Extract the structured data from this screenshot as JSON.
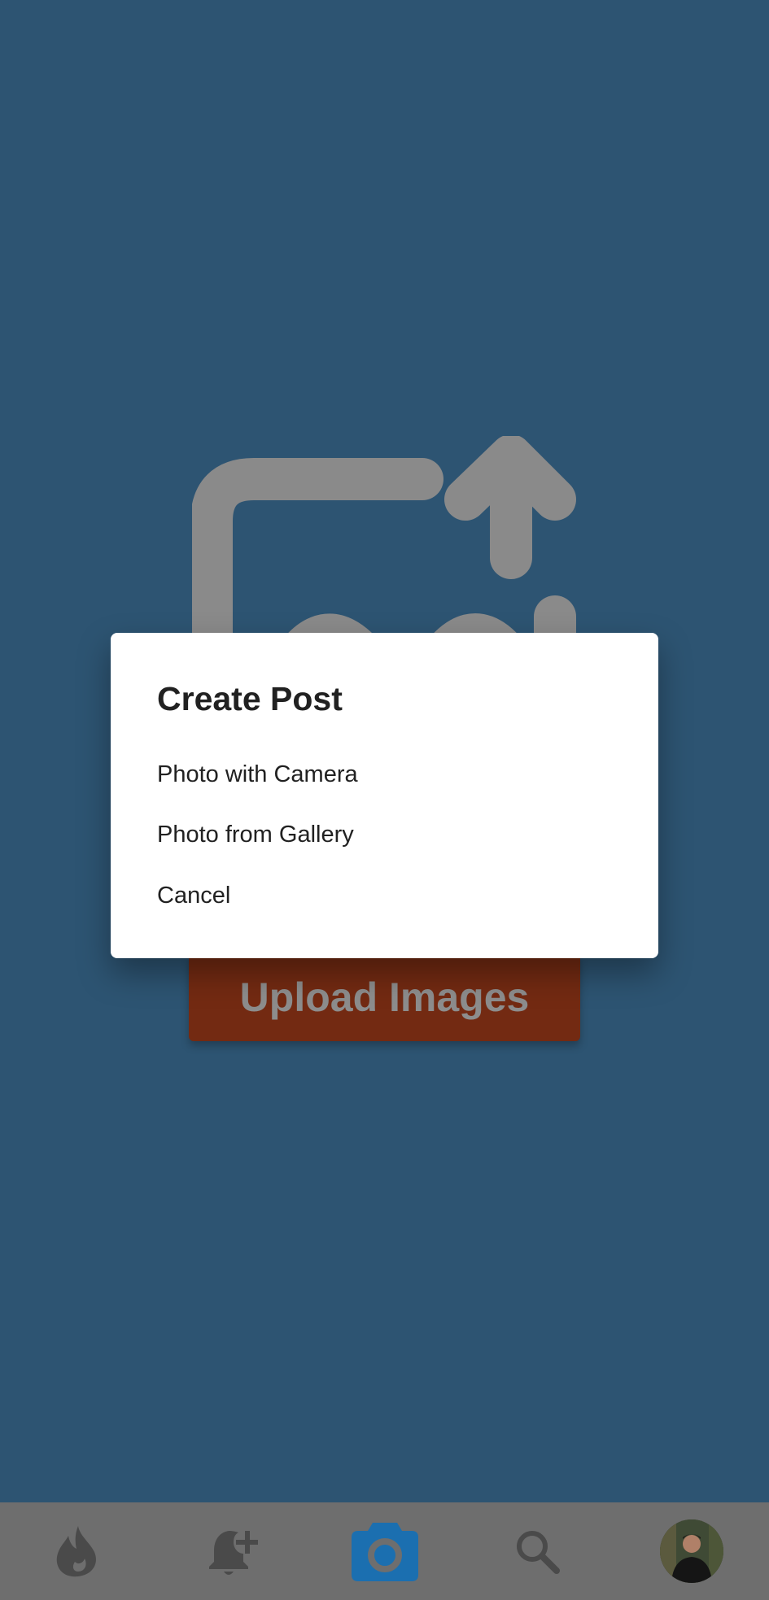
{
  "colors": {
    "background": "#2d5472",
    "dialog_background": "#ffffff",
    "upload_button": "#732a12",
    "nav_background": "#6e6e6e",
    "nav_active": "#1b6fb0",
    "icon_dim": "#8a8a8a"
  },
  "upload": {
    "icon": "image-upload-icon",
    "button_label": "Upload Images"
  },
  "dialog": {
    "title": "Create Post",
    "options": [
      {
        "label": "Photo with Camera"
      },
      {
        "label": "Photo from Gallery"
      },
      {
        "label": "Cancel"
      }
    ]
  },
  "bottom_nav": {
    "items": [
      {
        "icon": "flame-icon",
        "active": false
      },
      {
        "icon": "notification-add-icon",
        "active": false
      },
      {
        "icon": "camera-icon",
        "active": true
      },
      {
        "icon": "search-icon",
        "active": false
      },
      {
        "icon": "profile-avatar",
        "active": false
      }
    ]
  }
}
